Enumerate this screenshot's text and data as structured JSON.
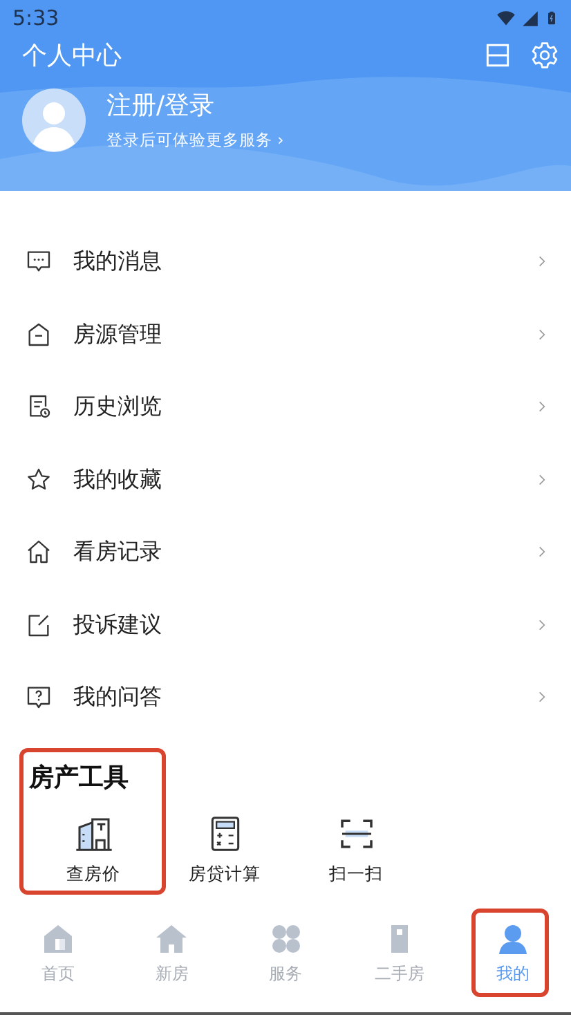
{
  "status_bar": {
    "time": "5:33"
  },
  "header": {
    "title": "个人中心"
  },
  "profile": {
    "name": "注册/登录",
    "subtitle": "登录后可体验更多服务 ›"
  },
  "menu": [
    {
      "label": "我的消息"
    },
    {
      "label": "房源管理"
    },
    {
      "label": "历史浏览"
    },
    {
      "label": "我的收藏"
    },
    {
      "label": "看房记录"
    },
    {
      "label": "投诉建议"
    },
    {
      "label": "我的问答"
    }
  ],
  "tools": {
    "title": "房产工具",
    "highlighted": true,
    "items": [
      {
        "label": "查房价"
      },
      {
        "label": "房贷计算"
      },
      {
        "label": "扫一扫"
      }
    ]
  },
  "tab_bar": [
    {
      "label": "首页",
      "selected": false,
      "highlighted": false
    },
    {
      "label": "新房",
      "selected": false,
      "highlighted": false
    },
    {
      "label": "服务",
      "selected": false,
      "highlighted": false
    },
    {
      "label": "二手房",
      "selected": false,
      "highlighted": false
    },
    {
      "label": "我的",
      "selected": true,
      "highlighted": true
    }
  ]
}
